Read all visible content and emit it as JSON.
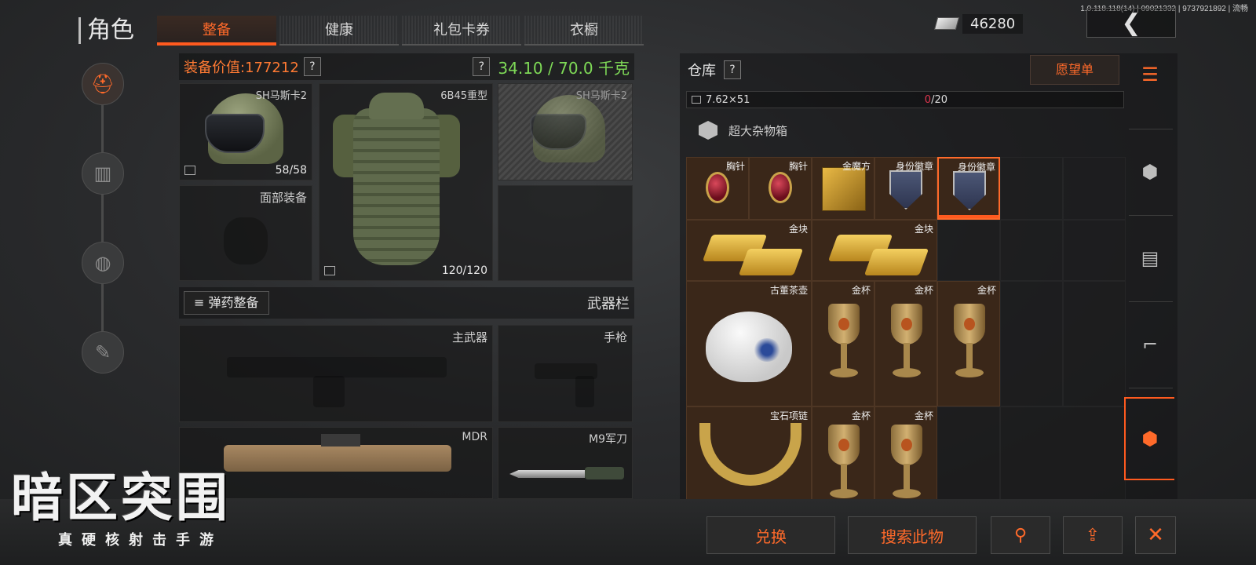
{
  "version": "1.0.118.118(14) | 09021332 | 9737921892 | 流畅",
  "header": {
    "title": "角色",
    "tabs": [
      {
        "label": "整备",
        "active": true
      },
      {
        "label": "健康"
      },
      {
        "label": "礼包卡券"
      },
      {
        "label": "衣橱"
      }
    ],
    "currency": "46280",
    "back_glyph": "❮"
  },
  "equipment": {
    "value_label": "装备价值:177212",
    "weight": "34.10 / 70.0 千克",
    "help": "?",
    "slots": {
      "helmet": {
        "label": "SH马斯卡2",
        "durability": "58/58"
      },
      "armor": {
        "label": "6B45重型",
        "durability": "120/120"
      },
      "helmet_preview": {
        "label": "SH马斯卡2"
      },
      "face": {
        "label": "面部装备"
      }
    },
    "ammo_button": "弹药整备",
    "weapons_label": "武器栏",
    "weapon_slots": {
      "primary": {
        "label": "主武器"
      },
      "pistol": {
        "label": "手枪"
      },
      "mdr": {
        "label": "MDR"
      },
      "knife": {
        "label": "M9军刀"
      }
    }
  },
  "logo": {
    "title": "暗区突围",
    "subtitle": "真硬核射击手游"
  },
  "storage": {
    "title": "仓库",
    "wishlist": "愿望单",
    "ammo_row": {
      "caliber": "7.62×51",
      "count": "0",
      "capacity": "/20"
    },
    "container_name": "超大杂物箱",
    "items": [
      {
        "name": "胸针"
      },
      {
        "name": "胸针"
      },
      {
        "name": "金魔方"
      },
      {
        "name": "身份徽章"
      },
      {
        "name": "身份徽章",
        "selected": true
      },
      {
        "name": "金块"
      },
      {
        "name": "金块"
      },
      {
        "name": "古董茶壶"
      },
      {
        "name": "金杯"
      },
      {
        "name": "金杯"
      },
      {
        "name": "金杯"
      },
      {
        "name": "宝石项链"
      },
      {
        "name": "金杯"
      },
      {
        "name": "金杯"
      }
    ]
  },
  "bottom": {
    "exchange": "兑换",
    "search_this": "搜索此物"
  },
  "colors": {
    "accent": "#ff6a2a",
    "weight_green": "#7ed957"
  }
}
